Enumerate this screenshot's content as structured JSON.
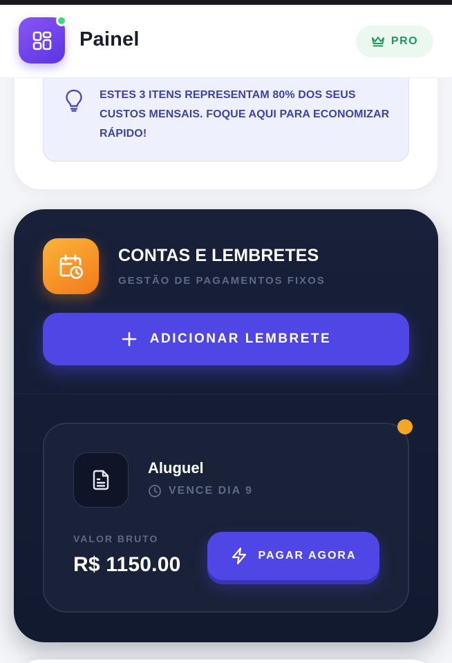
{
  "header": {
    "title": "Painel",
    "pro_badge": "PRO",
    "logo_icon": "dashboard-grid-icon",
    "status": "online"
  },
  "tip": {
    "icon": "lightbulb-icon",
    "text": "ESTES 3 ITENS REPRESENTAM 80% DOS SEUS CUSTOS MENSAIS. FOQUE AQUI PARA ECONOMIZAR RÁPIDO!"
  },
  "bills_section": {
    "icon": "calendar-clock-icon",
    "title": "CONTAS E LEMBRETES",
    "subtitle": "GESTÃO DE PAGAMENTOS FIXOS",
    "add_button_label": "ADICIONAR LEMBRETE",
    "items": [
      {
        "name": "Aluguel",
        "due_label": "VENCE DIA 9",
        "value_label": "VALOR BRUTO",
        "amount": "R$ 1150.00",
        "pay_button_label": "PAGAR AGORA",
        "status": "pending"
      }
    ]
  },
  "colors": {
    "accent": "#4f46e5",
    "logo_gradient": [
      "#8a56f5",
      "#5b34e2"
    ],
    "section_icon_gradient": [
      "#fbb43a",
      "#f27a1a"
    ],
    "dark_card": "#18203a",
    "pro_text": "#1a9a5e",
    "tip_text": "#3d42a8",
    "pending_dot": "#f5a623",
    "online_dot": "#3fd685"
  }
}
